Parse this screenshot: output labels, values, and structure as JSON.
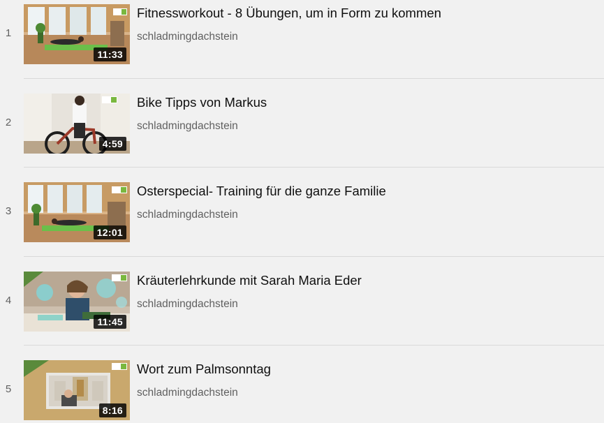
{
  "playlist": {
    "items": [
      {
        "index": "1",
        "title": "Fitnessworkout - 8 Übungen, um in Form zu kommen",
        "channel": "schladmingdachstein",
        "duration": "11:33",
        "thumbnail": "living-room-workout"
      },
      {
        "index": "2",
        "title": "Bike Tipps von Markus",
        "channel": "schladmingdachstein",
        "duration": "4:59",
        "thumbnail": "man-on-bike-trainer"
      },
      {
        "index": "3",
        "title": "Osterspecial- Training für die ganze Familie",
        "channel": "schladmingdachstein",
        "duration": "12:01",
        "thumbnail": "living-room-workout"
      },
      {
        "index": "4",
        "title": "Kräuterlehrkunde mit Sarah Maria Eder",
        "channel": "schladmingdachstein",
        "duration": "11:45",
        "thumbnail": "woman-with-herbs"
      },
      {
        "index": "5",
        "title": "Wort zum Palmsonntag",
        "channel": "schladmingdachstein",
        "duration": "8:16",
        "thumbnail": "church-interior"
      }
    ]
  }
}
